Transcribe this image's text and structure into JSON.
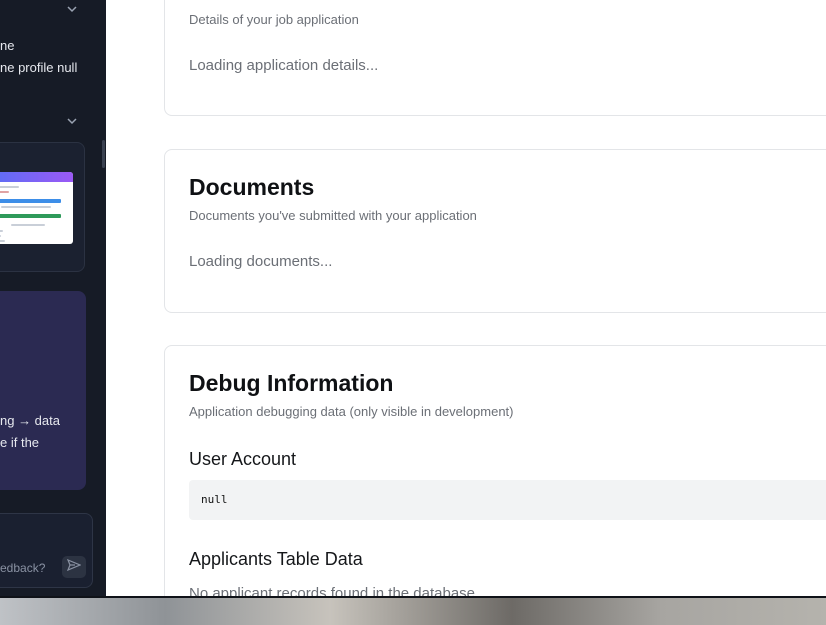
{
  "sidebar": {
    "text_line_1": "ne",
    "text_line_2": "ne profile null",
    "card_text_line_1": "ng → data",
    "card_text_line_2": "e if the",
    "input_placeholder": "edback?",
    "icons": [
      "chevron-down-icon",
      "chevron-down-icon",
      "send-icon"
    ]
  },
  "main": {
    "application_card": {
      "subtitle": "Details of your job application",
      "loading": "Loading application details..."
    },
    "documents_card": {
      "title": "Documents",
      "subtitle": "Documents you've submitted with your application",
      "loading": "Loading documents..."
    },
    "debug_card": {
      "title": "Debug Information",
      "subtitle": "Application debugging data (only visible in development)",
      "user_account_heading": "User Account",
      "user_account_value": "null",
      "applicants_heading": "Applicants Table Data",
      "applicants_value": "No applicant records found in the database"
    }
  },
  "colors": {
    "sidebar_bg": "#161b26",
    "purple_card": "#2b2a52",
    "main_bg": "#ffffff",
    "code_bg": "#f2f3f4"
  }
}
